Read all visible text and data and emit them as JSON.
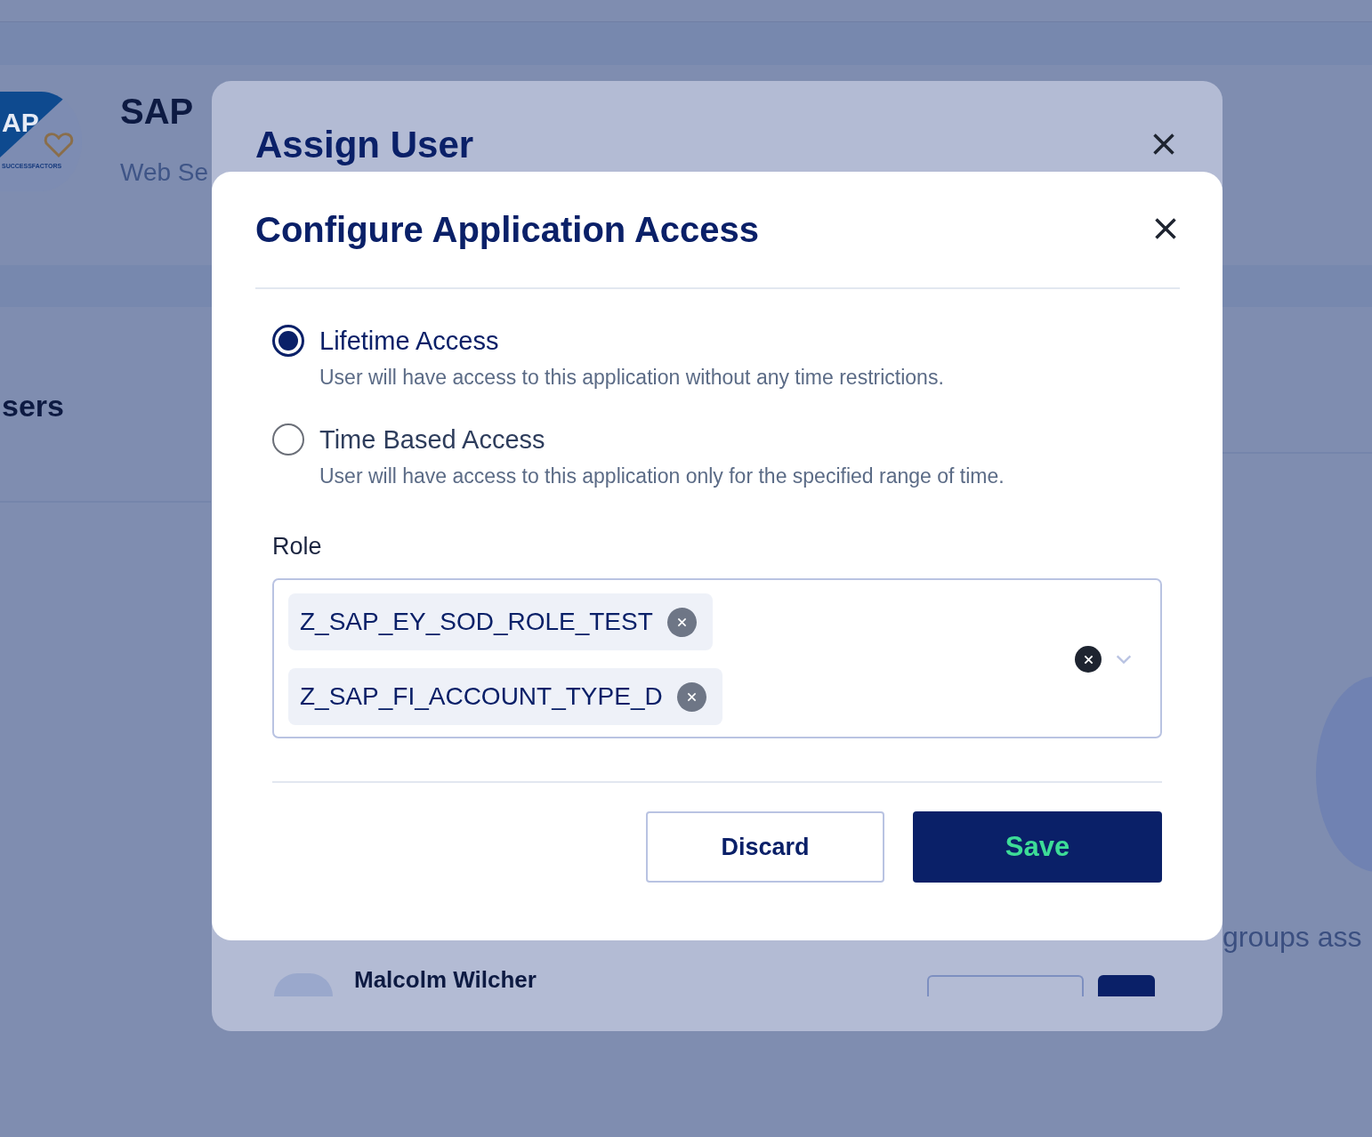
{
  "background": {
    "logo": {
      "wordmark": "AP",
      "caption": "SUCCESSFACTORS"
    },
    "app_title": "SAP",
    "app_subtitle": "Web Se",
    "section_title": "sers",
    "side_text": "groups ass"
  },
  "assign_dialog": {
    "title": "Assign User",
    "user_row": {
      "name": "Malcolm Wilcher"
    }
  },
  "access_dialog": {
    "title": "Configure Application Access",
    "options": [
      {
        "label": "Lifetime Access",
        "description": "User will have access to this application without any time restrictions.",
        "selected": true
      },
      {
        "label": "Time Based Access",
        "description": "User will have access to this application only for the specified range of time.",
        "selected": false
      }
    ],
    "role": {
      "label": "Role",
      "chips": [
        "Z_SAP_EY_SOD_ROLE_TEST",
        "Z_SAP_FI_ACCOUNT_TYPE_D"
      ]
    },
    "buttons": [
      {
        "label": "Discard",
        "kind": "secondary"
      },
      {
        "label": "Save",
        "kind": "primary"
      }
    ]
  }
}
